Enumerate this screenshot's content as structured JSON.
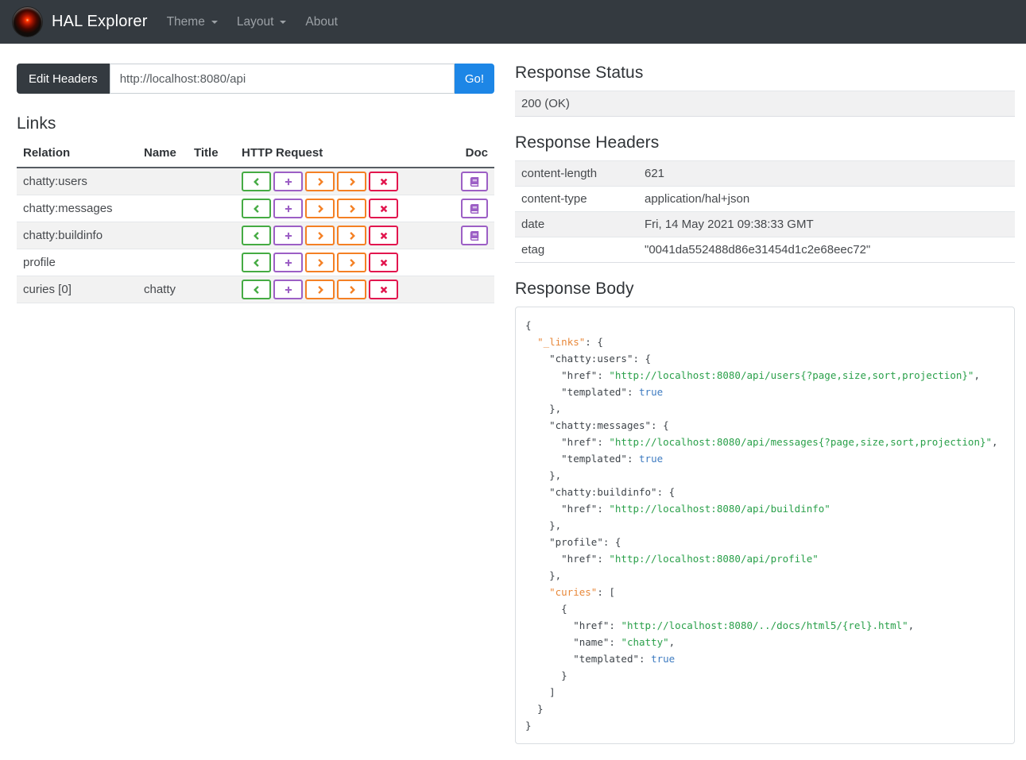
{
  "navbar": {
    "brand": "HAL Explorer",
    "menus": [
      {
        "label": "Theme",
        "caret": true
      },
      {
        "label": "Layout",
        "caret": true
      },
      {
        "label": "About",
        "caret": false
      }
    ]
  },
  "request_bar": {
    "edit_headers_label": "Edit Headers",
    "url_value": "http://localhost:8080/api",
    "go_label": "Go!"
  },
  "links": {
    "title": "Links",
    "columns": [
      "Relation",
      "Name",
      "Title",
      "HTTP Request",
      "Doc"
    ],
    "doc_icon": "book-icon",
    "http_buttons": [
      {
        "name": "get",
        "icon": "chevron-left-icon",
        "color_key": "get_green"
      },
      {
        "name": "post",
        "icon": "plus-icon",
        "color_key": "post_purple"
      },
      {
        "name": "put",
        "icon": "chevron-right-icon",
        "color_key": "put_orange"
      },
      {
        "name": "patch",
        "icon": "chevron-right-icon",
        "color_key": "patch_orange"
      },
      {
        "name": "delete",
        "icon": "x-icon",
        "color_key": "delete_red"
      }
    ],
    "rows": [
      {
        "relation": "chatty:users",
        "name": "",
        "title": "",
        "doc": true
      },
      {
        "relation": "chatty:messages",
        "name": "",
        "title": "",
        "doc": true
      },
      {
        "relation": "chatty:buildinfo",
        "name": "",
        "title": "",
        "doc": true
      },
      {
        "relation": "profile",
        "name": "",
        "title": "",
        "doc": false
      },
      {
        "relation": "curies [0]",
        "name": "chatty",
        "title": "",
        "doc": false
      }
    ]
  },
  "response_status": {
    "title": "Response Status",
    "value": "200 (OK)"
  },
  "response_headers": {
    "title": "Response Headers",
    "rows": [
      {
        "name": "content-length",
        "value": "621"
      },
      {
        "name": "content-type",
        "value": "application/hal+json"
      },
      {
        "name": "date",
        "value": "Fri, 14 May 2021 09:38:33 GMT"
      },
      {
        "name": "etag",
        "value": "\"0041da552488d86e31454d1c2e68eec72\""
      }
    ]
  },
  "response_body": {
    "title": "Response Body",
    "lines": [
      [
        [
          "p",
          "{"
        ]
      ],
      [
        [
          "p",
          "  "
        ],
        [
          "h",
          "\"_links\""
        ],
        [
          "p",
          ": {"
        ]
      ],
      [
        [
          "p",
          "    "
        ],
        [
          "k",
          "\"chatty:users\""
        ],
        [
          "p",
          ": {"
        ]
      ],
      [
        [
          "p",
          "      "
        ],
        [
          "k",
          "\"href\""
        ],
        [
          "p",
          ": "
        ],
        [
          "s",
          "\"http://localhost:8080/api/users{?page,size,sort,projection}\""
        ],
        [
          "p",
          ","
        ]
      ],
      [
        [
          "p",
          "      "
        ],
        [
          "k",
          "\"templated\""
        ],
        [
          "p",
          ": "
        ],
        [
          "b",
          "true"
        ]
      ],
      [
        [
          "p",
          "    },"
        ]
      ],
      [
        [
          "p",
          "    "
        ],
        [
          "k",
          "\"chatty:messages\""
        ],
        [
          "p",
          ": {"
        ]
      ],
      [
        [
          "p",
          "      "
        ],
        [
          "k",
          "\"href\""
        ],
        [
          "p",
          ": "
        ],
        [
          "s",
          "\"http://localhost:8080/api/messages{?page,size,sort,projection}\""
        ],
        [
          "p",
          ","
        ]
      ],
      [
        [
          "p",
          "      "
        ],
        [
          "k",
          "\"templated\""
        ],
        [
          "p",
          ": "
        ],
        [
          "b",
          "true"
        ]
      ],
      [
        [
          "p",
          "    },"
        ]
      ],
      [
        [
          "p",
          "    "
        ],
        [
          "k",
          "\"chatty:buildinfo\""
        ],
        [
          "p",
          ": {"
        ]
      ],
      [
        [
          "p",
          "      "
        ],
        [
          "k",
          "\"href\""
        ],
        [
          "p",
          ": "
        ],
        [
          "s",
          "\"http://localhost:8080/api/buildinfo\""
        ]
      ],
      [
        [
          "p",
          "    },"
        ]
      ],
      [
        [
          "p",
          "    "
        ],
        [
          "k",
          "\"profile\""
        ],
        [
          "p",
          ": {"
        ]
      ],
      [
        [
          "p",
          "      "
        ],
        [
          "k",
          "\"href\""
        ],
        [
          "p",
          ": "
        ],
        [
          "s",
          "\"http://localhost:8080/api/profile\""
        ]
      ],
      [
        [
          "p",
          "    },"
        ]
      ],
      [
        [
          "p",
          "    "
        ],
        [
          "h",
          "\"curies\""
        ],
        [
          "p",
          ": ["
        ]
      ],
      [
        [
          "p",
          "      {"
        ]
      ],
      [
        [
          "p",
          "        "
        ],
        [
          "k",
          "\"href\""
        ],
        [
          "p",
          ": "
        ],
        [
          "s",
          "\"http://localhost:8080/../docs/html5/{rel}.html\""
        ],
        [
          "p",
          ","
        ]
      ],
      [
        [
          "p",
          "        "
        ],
        [
          "k",
          "\"name\""
        ],
        [
          "p",
          ": "
        ],
        [
          "s",
          "\"chatty\""
        ],
        [
          "p",
          ","
        ]
      ],
      [
        [
          "p",
          "        "
        ],
        [
          "k",
          "\"templated\""
        ],
        [
          "p",
          ": "
        ],
        [
          "b",
          "true"
        ]
      ],
      [
        [
          "p",
          "      }"
        ]
      ],
      [
        [
          "p",
          "    ]"
        ]
      ],
      [
        [
          "p",
          "  }"
        ]
      ],
      [
        [
          "p",
          "}"
        ]
      ]
    ]
  },
  "colors": {
    "navbar_bg": "#343a40",
    "accent_blue": "#1d86e6",
    "get_green": "#45ab43",
    "post_purple": "#9c5fc5",
    "put_orange": "#f48024",
    "patch_orange": "#f48024",
    "delete_red": "#e2164e",
    "doc_purple": "#9c5fc5",
    "json_key": "#3e444a",
    "json_hal_key": "#e8883a",
    "json_string": "#2aa04a",
    "json_boolean": "#3f7cc1"
  }
}
